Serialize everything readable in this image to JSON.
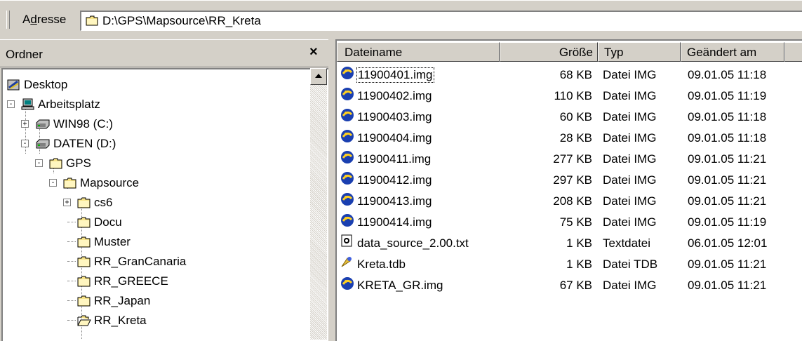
{
  "address": {
    "label_pre": "A",
    "label_accel": "d",
    "label_post": "resse",
    "path": "D:\\GPS\\Mapsource\\RR_Kreta"
  },
  "folders": {
    "title": "Ordner",
    "close": "×",
    "tree": [
      {
        "label": "Desktop",
        "icon": "desktop-icon"
      },
      {
        "label": "Arbeitsplatz",
        "icon": "computer-icon"
      },
      {
        "label": "WIN98 (C:)",
        "icon": "drive-icon"
      },
      {
        "label": "DATEN (D:)",
        "icon": "drive-icon"
      },
      {
        "label": "GPS",
        "icon": "folder-icon"
      },
      {
        "label": "Mapsource",
        "icon": "folder-icon"
      },
      {
        "label": "cs6",
        "icon": "folder-icon"
      },
      {
        "label": "Docu",
        "icon": "folder-icon"
      },
      {
        "label": "Muster",
        "icon": "folder-icon"
      },
      {
        "label": "RR_GranCanaria",
        "icon": "folder-icon"
      },
      {
        "label": "RR_GREECE",
        "icon": "folder-icon"
      },
      {
        "label": "RR_Japan",
        "icon": "folder-icon"
      },
      {
        "label": "RR_Kreta",
        "icon": "open-folder-icon"
      }
    ]
  },
  "files": {
    "columns": [
      "Dateiname",
      "Größe",
      "Typ",
      "Geändert am"
    ],
    "rows": [
      {
        "name": "11900401.img",
        "size": "68 KB",
        "type": "Datei IMG",
        "modified": "09.01.05 11:18",
        "icon": "img-file-icon"
      },
      {
        "name": "11900402.img",
        "size": "110 KB",
        "type": "Datei IMG",
        "modified": "09.01.05 11:19",
        "icon": "img-file-icon"
      },
      {
        "name": "11900403.img",
        "size": "60 KB",
        "type": "Datei IMG",
        "modified": "09.01.05 11:18",
        "icon": "img-file-icon"
      },
      {
        "name": "11900404.img",
        "size": "28 KB",
        "type": "Datei IMG",
        "modified": "09.01.05 11:18",
        "icon": "img-file-icon"
      },
      {
        "name": "11900411.img",
        "size": "277 KB",
        "type": "Datei IMG",
        "modified": "09.01.05 11:21",
        "icon": "img-file-icon"
      },
      {
        "name": "11900412.img",
        "size": "297 KB",
        "type": "Datei IMG",
        "modified": "09.01.05 11:21",
        "icon": "img-file-icon"
      },
      {
        "name": "11900413.img",
        "size": "208 KB",
        "type": "Datei IMG",
        "modified": "09.01.05 11:21",
        "icon": "img-file-icon"
      },
      {
        "name": "11900414.img",
        "size": "75 KB",
        "type": "Datei IMG",
        "modified": "09.01.05 11:19",
        "icon": "img-file-icon"
      },
      {
        "name": "data_source_2.00.txt",
        "size": "1 KB",
        "type": "Textdatei",
        "modified": "06.01.05 12:01",
        "icon": "text-file-icon"
      },
      {
        "name": "Kreta.tdb",
        "size": "1 KB",
        "type": "Datei TDB",
        "modified": "09.01.05 11:21",
        "icon": "tdb-file-icon"
      },
      {
        "name": "KRETA_GR.img",
        "size": "67 KB",
        "type": "Datei IMG",
        "modified": "09.01.05 11:21",
        "icon": "img-file-icon"
      }
    ]
  }
}
